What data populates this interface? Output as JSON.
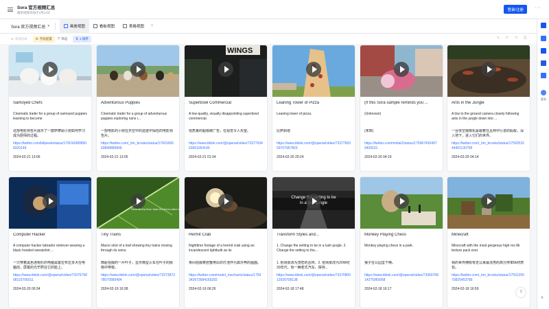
{
  "header": {
    "title": "Sora 官方视频汇总",
    "subtitle": "最新视频添加于2月21日",
    "login_label": "登录/注册",
    "more_label": "···"
  },
  "tabbar": {
    "table_name": "Sora 官方视频汇总",
    "tabs": [
      {
        "label": "画册视图",
        "active": true
      },
      {
        "label": "看板视图",
        "active": false
      },
      {
        "label": "表格视图",
        "active": false
      }
    ],
    "more_label": "+"
  },
  "toolbar": {
    "add_record": "添加记录",
    "filter_chip": "字段配置",
    "filter": "筛选",
    "sort_chip": "1 排序"
  },
  "cards": [
    {
      "title": "Samoyed Chefs",
      "desc": "Cinematic trailer for a group of samoyed puppies learning to become",
      "zh": "这部电影预告片展示了一群萨摩耶小狗如何学习成为厨师的过程。",
      "link": "https://twitter.com/billpeeb/status/1760169898908320149",
      "date": "2024-02-21 13:06",
      "thumb": "samoyed"
    },
    {
      "title": "Adventurous Puppies",
      "desc": "Cinematic trailer for a group of adventurous puppies exploring ruins i...",
      "zh": "一部电影的小狗在天空中的遗迹中探险的电影预告片。",
      "link": "https://twitter.com/_tim_brooks/status/1760166660898885899",
      "date": "2024-02-21 13:05",
      "thumb": "puppies"
    },
    {
      "title": "Superbowl Commercial",
      "desc": "A low-quality, visually disappointing superbowl commercial.",
      "zh": "低质量的超级碗广告，在视觉令人失望。",
      "link": "https://www.tiktok.com/@openai/video/7337763463951654190",
      "date": "2024-02-21 01:34",
      "thumb": "wings"
    },
    {
      "title": "Leaning Tower of Pizza",
      "desc": "Leaning tower of pizza.",
      "zh": "比萨斜塔",
      "link": "https://www.tiktok.com/@openai/video/7337782059707957803",
      "date": "2024-02-20 20:24",
      "thumb": "pizza"
    },
    {
      "title": "(If this Sora sample reminds you ...",
      "desc": "(Unknown)",
      "zh": "(未知)",
      "link": "https://twitter.com/minlai2/status/1759674924979409151",
      "date": "2024-02-20 04:19",
      "thumb": "market"
    },
    {
      "title": "Ants in the Jungle",
      "desc": "A low to the ground camera closely following ants in the jungle down into ...",
      "zh": "一台低空摄像机紧跟着在丛林中行进的蚂蚁，深入地下，进入它们的世界。",
      "link": "https://twitter.com/_tim_brooks/status/1759253244401130758",
      "date": "2024-02-20 04:14",
      "thumb": "ants"
    },
    {
      "title": "Computer Hacker",
      "desc": "A computer hacker labrador retriever wearing a black hooded sweatshirt ...",
      "zh": "一只穿着黑色连帽衫的电脑黑客拉布拉多犬在电脑前，屏幕的光芒照在它的脸上。",
      "link": "https://www.tiktok.com/@openai/video/7337675898115706011",
      "date": "2024-02-20 00:34",
      "thumb": "hacker"
    },
    {
      "title": "Tiny Trains",
      "desc": "Macro shot of a leaf showing tiny trains moving through its veins.",
      "zh": "微距拍摄的一片叶子，显示微型火车在叶子的脉络中穿梭。",
      "link": "https://www.tiktok.com/@openai/video/7337387378070580494",
      "date": "2024-02-19 16:38",
      "thumb": "leaf"
    },
    {
      "title": "Hermit Crab",
      "desc": "Nighttime footage of a hermit crab using an incandescent lightbulb as its",
      "zh": "夜间拍摄寄居蟹用白炽灯泡作为其外壳的画面。",
      "link": "https://twitter.com/model_mechanic/status/1759343673684165292",
      "date": "2024-02-19 06:26",
      "thumb": "crab"
    },
    {
      "title": "Transform Styles and...",
      "desc": "1. Change the setting to be in a lush jungle. 2. Change the setting to the...",
      "zh": "1. 把场景改为茂密的丛林。2. 把场景改为20世纪20年代，有一辆老式汽车，保持...",
      "link": "https://www.tiktok.com/@openai/video/7337080012926708138",
      "date": "2024-02-18 17:48",
      "thumb": "road"
    },
    {
      "title": "Monkey Playing Chess",
      "desc": "Monkey playing chess in a park.",
      "zh": "猴子在公园里下棋。",
      "link": "https://www.tiktok.com/@openai/video/7336976814275965958",
      "date": "2024-02-18 16:17",
      "thumb": "monkey"
    },
    {
      "title": "Minecraft",
      "desc": "Minecraft with the most gorgeous high res 8k texture pack ever.",
      "zh": "我的世界拥有有史以来最漂亮的高分辨率8k材质包。",
      "link": "https://twitter.com/_tim_brooks/status/1759125570825453785",
      "date": "2024-02-18 16:59",
      "thumb": "minecraft"
    }
  ],
  "thumb_text": {
    "wings": "WINGS",
    "leaf_caption": "Generated by Sora. Open AI's text-to-video model",
    "road_caption_1": "Change the setting to be",
    "road_caption_2": "in a lush jungle"
  },
  "rightbar": {
    "label": "更多"
  },
  "help_label": "?"
}
